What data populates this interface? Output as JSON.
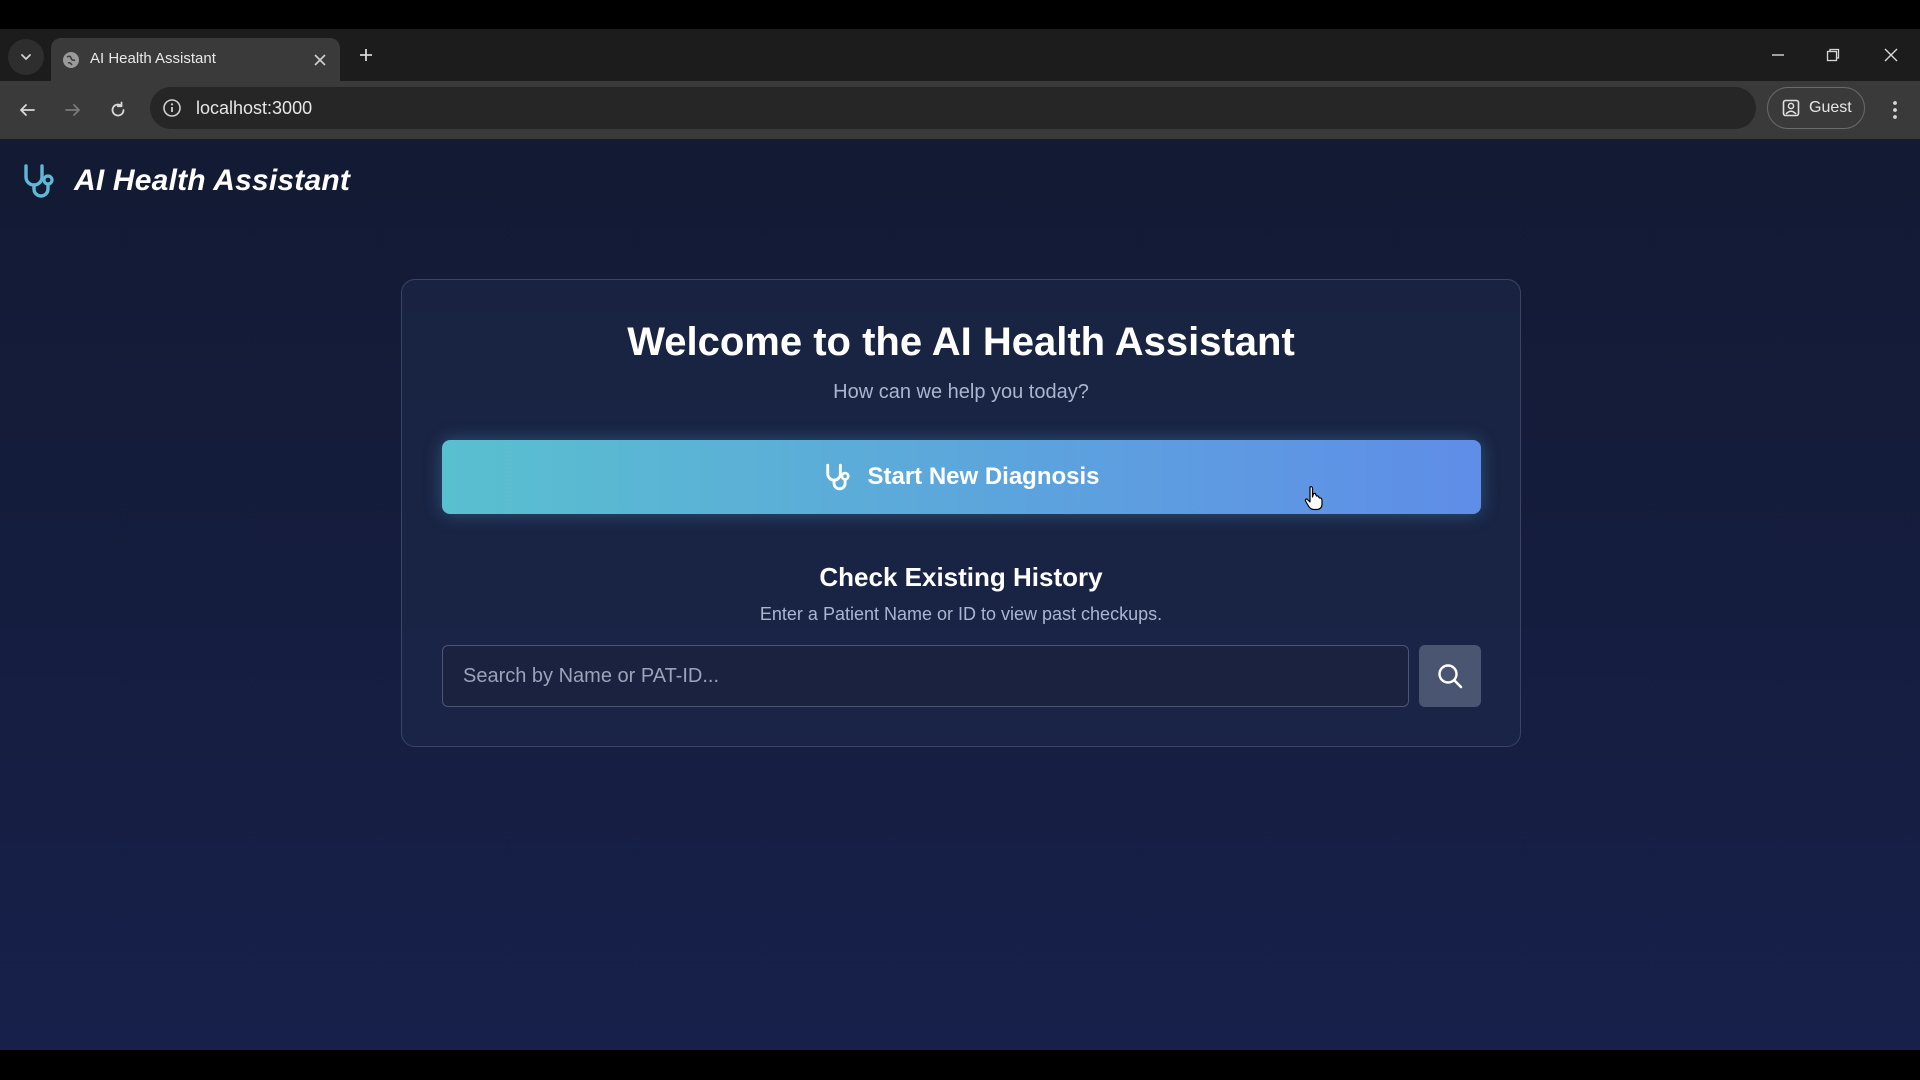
{
  "browser": {
    "tab": {
      "title": "AI Health Assistant"
    },
    "url": "localhost:3000",
    "profile_label": "Guest",
    "icons": {
      "tab_dropdown": "chevron-down-icon",
      "favicon": "globe-icon",
      "tab_close": "close-icon",
      "new_tab": "plus-icon",
      "minimize": "minimize-icon",
      "restore": "restore-icon",
      "close_window": "close-icon",
      "back": "arrow-left-icon",
      "forward": "arrow-right-icon",
      "reload": "reload-icon",
      "site_info": "info-icon",
      "profile": "profile-icon",
      "menu": "kebab-menu-icon"
    }
  },
  "app": {
    "brand_title": "AI Health Assistant",
    "brand_icon": "stethoscope-icon",
    "welcome_title": "Welcome to the AI Health Assistant",
    "welcome_subtitle": "How can we help you today?",
    "diagnosis_button_label": "Start New Diagnosis",
    "history_title": "Check Existing History",
    "history_subtitle": "Enter a Patient Name or ID to view past checkups.",
    "search": {
      "placeholder": "Search by Name or PAT-ID...",
      "value": "",
      "button_icon": "search-icon"
    }
  },
  "colors": {
    "page_bg_top": "#131a33",
    "page_bg_bottom": "#17204a",
    "accent_teal": "#59c0cf",
    "accent_blue": "#5f8de8",
    "brand_icon_color": "#5fb8d6"
  }
}
